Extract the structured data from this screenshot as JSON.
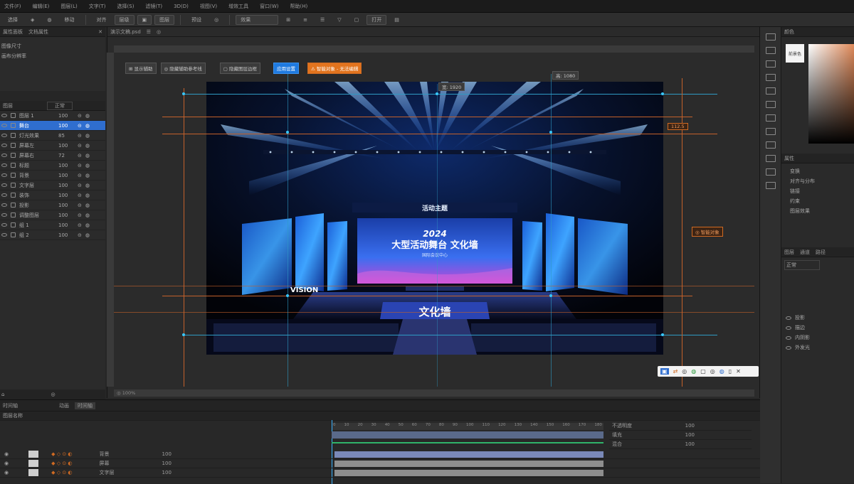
{
  "menubar": {
    "items": [
      "文件(F)",
      "编辑(E)",
      "图层(L)",
      "文字(T)",
      "选择(S)",
      "滤镜(T)",
      "3D(D)",
      "视图(V)",
      "增效工具",
      "窗口(W)",
      "帮助(H)",
      "",
      "",
      ""
    ]
  },
  "toolbar": {
    "items": [
      "选择",
      "◈",
      "◍",
      "移动",
      "对齐",
      "层级",
      "▣",
      "图层",
      "预设",
      "◎",
      "效果",
      "⊞",
      "≡",
      "☰",
      "▽",
      "▢",
      "打开",
      "▤"
    ]
  },
  "canvas": {
    "tab_title": "演示文稿.psd",
    "tab_items": [
      "☰",
      "◎"
    ],
    "top_buttons": [
      "⊞ 显示辅助",
      "◎ 隐藏辅助参考线",
      "▢ 隐藏图层边框"
    ],
    "tag_blue": "应用设置",
    "tag_orange": "⚠ 智能对象 - 无法编辑",
    "measure_top": "宽: 1920",
    "measure_top_right": "高: 1080",
    "measure_right": "112.5",
    "measure_right_orange": "◎ 智能对象",
    "screen_year": "2024",
    "screen_title": "大型活动舞台 文化墙",
    "screen_sub": "国际会议中心",
    "stage_label": "文化墙",
    "header_banner": "活动主题",
    "side_label": "VISION",
    "status_left": "◎ 100%",
    "float_toolbar": [
      "▣",
      "⇄",
      "◎",
      "◍",
      "▢",
      "◎",
      "◍",
      "▯",
      "✕"
    ]
  },
  "left": {
    "panel1_title": "属性面板",
    "panel1_tab": "文档属性",
    "panel1_items": [
      "图像尺寸",
      "画布分辨率"
    ],
    "panel2_title": "图层",
    "panel2_mode": "正常",
    "layers": [
      {
        "name": "图层 1",
        "val": "100"
      },
      {
        "name": "舞台",
        "val": "100"
      },
      {
        "name": "灯光效果",
        "val": "85"
      },
      {
        "name": "屏幕左",
        "val": "100"
      },
      {
        "name": "屏幕右",
        "val": "72"
      },
      {
        "name": "标题",
        "val": "100"
      },
      {
        "name": "背景",
        "val": "100"
      },
      {
        "name": "文字层",
        "val": "100"
      },
      {
        "name": "装饰",
        "val": "100"
      },
      {
        "name": "投影",
        "val": "100"
      },
      {
        "name": "调整图层",
        "val": "100"
      },
      {
        "name": "组 1",
        "val": "100"
      },
      {
        "name": "组 2",
        "val": "100"
      }
    ]
  },
  "timeline": {
    "title": "时间轴",
    "tabs": [
      "动画",
      "时间轴"
    ],
    "layer_label": "图层名称",
    "ticks": [
      "0",
      "10",
      "20",
      "30",
      "40",
      "50",
      "60",
      "70",
      "80",
      "90",
      "100",
      "110",
      "120",
      "130",
      "140",
      "150",
      "160",
      "170",
      "180"
    ],
    "tracks": [
      {
        "name": "背景",
        "value": "100"
      },
      {
        "name": "屏幕",
        "value": "100"
      },
      {
        "name": "文字层",
        "value": "100"
      }
    ],
    "right_labels": [
      "不透明度",
      "填充",
      "混合"
    ],
    "right_values": [
      "100",
      "100",
      "100"
    ]
  },
  "right": {
    "color_title": "颜色",
    "swatch_label": "前景色",
    "props_title": "属性",
    "props_items": [
      "变换",
      "对齐与分布",
      "链接",
      "约束",
      "图层效果"
    ],
    "tabs": [
      "图层",
      "通道",
      "路径"
    ],
    "mode": "正常",
    "fx_items": [
      "投影",
      "描边",
      "内阴影",
      "外发光"
    ]
  },
  "colors": {
    "accent": "#2f6ecf",
    "orange": "#d06a22",
    "guide_blue": "#2f9bc4",
    "guide_orange": "#c4612a"
  }
}
